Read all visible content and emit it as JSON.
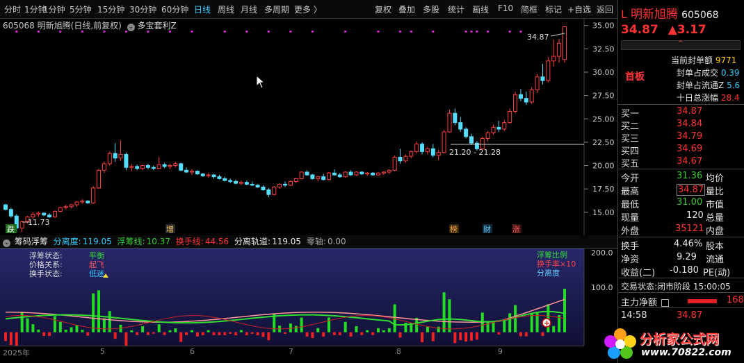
{
  "toolbar": {
    "periods": [
      "分时",
      "1分钟",
      "5分钟",
      "15分钟",
      "30分钟",
      "60分钟",
      "日线",
      "周线",
      "月线",
      "多周期",
      "更多 〉"
    ],
    "active_period": "日线",
    "tools": [
      "复权",
      "叠加",
      "多股",
      "统计",
      "画线",
      "F10",
      "简框",
      "标记",
      "+自选",
      "返回"
    ]
  },
  "ticker": {
    "code": "605068",
    "name": "明新旭腾",
    "mode": "(日线,前复权)",
    "formula": "多宝套利Z"
  },
  "price_axis": [
    "35.00",
    "32.50",
    "30.00",
    "27.50",
    "25.00",
    "22.50",
    "20.00",
    "17.50",
    "15.00"
  ],
  "annotations": {
    "high": "34.87",
    "low": "11.73",
    "range": "21.20 - 21.28"
  },
  "markers": {
    "die": "跌",
    "zeng": "增",
    "bang": "榜",
    "cai": "财",
    "zhang": "涨"
  },
  "indicator": {
    "name": "筹码浮筹",
    "fenli_label": "分离度:",
    "fenli": "119.05",
    "fuchou_label": "浮筹线:",
    "fuchou": "10.37",
    "huanshou_label": "换手线:",
    "huanshou": "44.56",
    "guidao_label": "分离轨道:",
    "guidao": "119.05",
    "zero_label": "零轴:",
    "zero": "0.00"
  },
  "sub": {
    "labels": [
      "浮筹状态:",
      "价格关系:",
      "换手状态:"
    ],
    "values": [
      "平衡",
      "起飞",
      "低迷"
    ],
    "legend": [
      "浮筹比例",
      "换手率×10",
      "分离度"
    ],
    "axis": [
      "200.0",
      "100.0"
    ]
  },
  "xaxis": [
    "2025年",
    "5",
    "6",
    "7",
    "8",
    "9"
  ],
  "right": {
    "flag": "L",
    "name": "明新旭腾",
    "code": "605068",
    "price": "34.87",
    "change": "▲3.17",
    "board": "首板",
    "seal": [
      [
        "当前封单额",
        "9771"
      ],
      [
        "封单占成交",
        "0.39"
      ],
      [
        "封单占流通Z",
        "5.6"
      ],
      [
        "十日总涨幅",
        "28.4"
      ]
    ],
    "bids": [
      [
        "买一",
        "34.87"
      ],
      [
        "买二",
        "34.84"
      ],
      [
        "买三",
        "34.79"
      ],
      [
        "买四",
        "34.69"
      ],
      [
        "买五",
        "34.67"
      ]
    ],
    "quote": [
      [
        "今开",
        "31.36",
        "均价"
      ],
      [
        "最高",
        "34.87",
        "量比"
      ],
      [
        "最低",
        "31.00",
        "市值"
      ],
      [
        "现量",
        "120",
        "总量"
      ],
      [
        "外盘",
        "35121",
        "内盘"
      ]
    ],
    "stats": [
      [
        "换手",
        "4.46%",
        "股本"
      ],
      [
        "净资",
        "9.29",
        "流通"
      ],
      [
        "收益(二)",
        "-0.180",
        "PE(动)"
      ]
    ],
    "status_label": "交易状态:",
    "status": "闭市阶段 15:00:05",
    "main_label": "主力净额",
    "main_value": "168",
    "tick_time": "14:58",
    "tick_price": "34.87"
  },
  "watermark": {
    "cn": "分析家公式网",
    "url": "www.70822.com"
  },
  "chart_data": {
    "type": "candlestick",
    "ylim": [
      13.5,
      35.5
    ],
    "candles": [
      [
        15.8,
        15.9,
        15.2,
        15.3
      ],
      [
        15.3,
        15.5,
        14.4,
        14.6
      ],
      [
        14.6,
        14.8,
        12.8,
        13.3
      ],
      [
        13.3,
        14.1,
        12.9,
        14.0
      ],
      [
        14.0,
        14.6,
        13.8,
        14.5
      ],
      [
        14.5,
        15.0,
        14.3,
        14.8
      ],
      [
        14.8,
        15.1,
        14.5,
        14.9
      ],
      [
        14.9,
        15.0,
        14.6,
        14.7
      ],
      [
        14.7,
        14.9,
        14.4,
        14.5
      ],
      [
        14.5,
        15.2,
        14.4,
        15.1
      ],
      [
        15.1,
        15.6,
        15.0,
        15.5
      ],
      [
        15.5,
        15.8,
        15.3,
        15.6
      ],
      [
        15.6,
        15.9,
        15.4,
        15.8
      ],
      [
        15.8,
        16.2,
        15.6,
        16.1
      ],
      [
        16.1,
        16.4,
        15.9,
        16.2
      ],
      [
        16.2,
        16.3,
        15.9,
        16.0
      ],
      [
        16.0,
        17.8,
        15.9,
        17.6
      ],
      [
        17.6,
        19.6,
        17.5,
        19.5
      ],
      [
        19.5,
        20.4,
        19.2,
        20.2
      ],
      [
        20.2,
        21.5,
        20.0,
        21.3
      ],
      [
        21.3,
        22.4,
        20.4,
        20.8
      ],
      [
        20.8,
        22.7,
        20.5,
        21.2
      ],
      [
        21.2,
        21.4,
        19.5,
        19.8
      ],
      [
        19.8,
        20.2,
        19.4,
        19.9
      ],
      [
        19.9,
        20.1,
        19.5,
        19.7
      ],
      [
        19.7,
        20.1,
        19.5,
        20.0
      ],
      [
        20.0,
        20.2,
        19.6,
        19.8
      ],
      [
        19.8,
        20.0,
        19.5,
        19.7
      ],
      [
        19.7,
        20.9,
        19.6,
        20.1
      ],
      [
        20.1,
        20.3,
        19.7,
        19.9
      ],
      [
        19.9,
        20.2,
        19.6,
        20.0
      ],
      [
        20.0,
        20.4,
        19.8,
        20.2
      ],
      [
        20.2,
        20.3,
        19.4,
        19.5
      ],
      [
        19.5,
        19.8,
        19.2,
        19.3
      ],
      [
        19.3,
        19.6,
        19.0,
        19.4
      ],
      [
        19.4,
        19.5,
        19.0,
        19.1
      ],
      [
        19.1,
        19.2,
        18.8,
        18.9
      ],
      [
        18.9,
        19.2,
        18.7,
        19.0
      ],
      [
        19.0,
        19.1,
        18.6,
        18.8
      ],
      [
        18.8,
        19.0,
        18.5,
        18.6
      ],
      [
        18.6,
        18.8,
        18.3,
        18.4
      ],
      [
        18.4,
        18.6,
        18.1,
        18.3
      ],
      [
        18.3,
        18.5,
        18.0,
        18.1
      ],
      [
        18.1,
        18.4,
        17.9,
        18.2
      ],
      [
        18.2,
        18.4,
        17.9,
        18.0
      ],
      [
        18.0,
        18.3,
        17.8,
        17.9
      ],
      [
        17.9,
        18.0,
        17.6,
        17.7
      ],
      [
        17.7,
        17.9,
        17.3,
        17.4
      ],
      [
        17.4,
        17.6,
        16.6,
        16.9
      ],
      [
        16.9,
        17.8,
        16.8,
        17.7
      ],
      [
        17.7,
        18.1,
        17.5,
        18.0
      ],
      [
        18.0,
        18.3,
        17.7,
        17.9
      ],
      [
        17.9,
        18.4,
        17.8,
        18.3
      ],
      [
        18.3,
        18.7,
        18.1,
        18.6
      ],
      [
        18.6,
        19.4,
        18.5,
        19.3
      ],
      [
        19.3,
        19.5,
        18.9,
        19.0
      ],
      [
        19.0,
        19.1,
        18.5,
        18.6
      ],
      [
        18.6,
        18.9,
        18.3,
        18.8
      ],
      [
        18.8,
        19.1,
        18.4,
        18.5
      ],
      [
        18.5,
        19.3,
        18.4,
        19.2
      ],
      [
        19.2,
        19.6,
        18.9,
        19.0
      ],
      [
        19.0,
        19.2,
        18.7,
        18.8
      ],
      [
        18.8,
        19.4,
        18.7,
        19.3
      ],
      [
        19.3,
        19.5,
        18.9,
        19.0
      ],
      [
        19.0,
        19.4,
        18.9,
        19.3
      ],
      [
        19.3,
        19.4,
        19.0,
        19.1
      ],
      [
        19.1,
        19.3,
        18.9,
        19.2
      ],
      [
        19.2,
        19.3,
        18.9,
        19.0
      ],
      [
        19.0,
        19.3,
        18.9,
        19.2
      ],
      [
        19.2,
        19.4,
        19.0,
        19.3
      ],
      [
        19.3,
        19.6,
        19.1,
        19.5
      ],
      [
        19.5,
        21.1,
        19.4,
        20.9
      ],
      [
        20.9,
        21.8,
        20.2,
        20.5
      ],
      [
        20.5,
        21.2,
        20.3,
        21.0
      ],
      [
        21.0,
        21.6,
        20.8,
        21.5
      ],
      [
        21.5,
        22.6,
        21.3,
        22.3
      ],
      [
        22.3,
        22.5,
        21.2,
        21.5
      ],
      [
        21.5,
        22.0,
        21.2,
        21.8
      ],
      [
        21.8,
        22.3,
        20.9,
        21.1
      ],
      [
        21.1,
        21.7,
        20.6,
        21.4
      ],
      [
        21.4,
        23.8,
        21.3,
        23.6
      ],
      [
        23.6,
        26.0,
        23.5,
        25.6
      ],
      [
        25.6,
        26.1,
        24.3,
        24.6
      ],
      [
        24.6,
        25.2,
        23.6,
        23.9
      ],
      [
        23.9,
        24.1,
        22.9,
        23.1
      ],
      [
        23.1,
        23.4,
        22.2,
        22.4
      ],
      [
        22.4,
        22.6,
        21.6,
        21.8
      ],
      [
        21.8,
        23.1,
        21.7,
        22.9
      ],
      [
        22.9,
        23.7,
        22.6,
        23.5
      ],
      [
        23.5,
        24.4,
        23.3,
        24.1
      ],
      [
        24.1,
        24.8,
        23.6,
        23.9
      ],
      [
        23.9,
        24.9,
        23.7,
        24.6
      ],
      [
        24.6,
        26.1,
        24.5,
        25.8
      ],
      [
        25.8,
        27.9,
        25.6,
        27.6
      ],
      [
        27.6,
        28.2,
        26.9,
        27.2
      ],
      [
        27.2,
        27.9,
        26.5,
        26.8
      ],
      [
        26.8,
        28.4,
        26.6,
        28.1
      ],
      [
        28.1,
        29.8,
        27.8,
        29.5
      ],
      [
        29.5,
        30.9,
        28.7,
        29.1
      ],
      [
        29.1,
        31.6,
        28.9,
        31.2
      ],
      [
        31.2,
        33.5,
        30.6,
        31.7
      ],
      [
        31.7,
        33.6,
        31.0,
        33.1
      ],
      [
        31.36,
        34.87,
        31.0,
        34.87
      ]
    ],
    "subchart": {
      "ylim": [
        -40,
        250
      ]
    }
  }
}
